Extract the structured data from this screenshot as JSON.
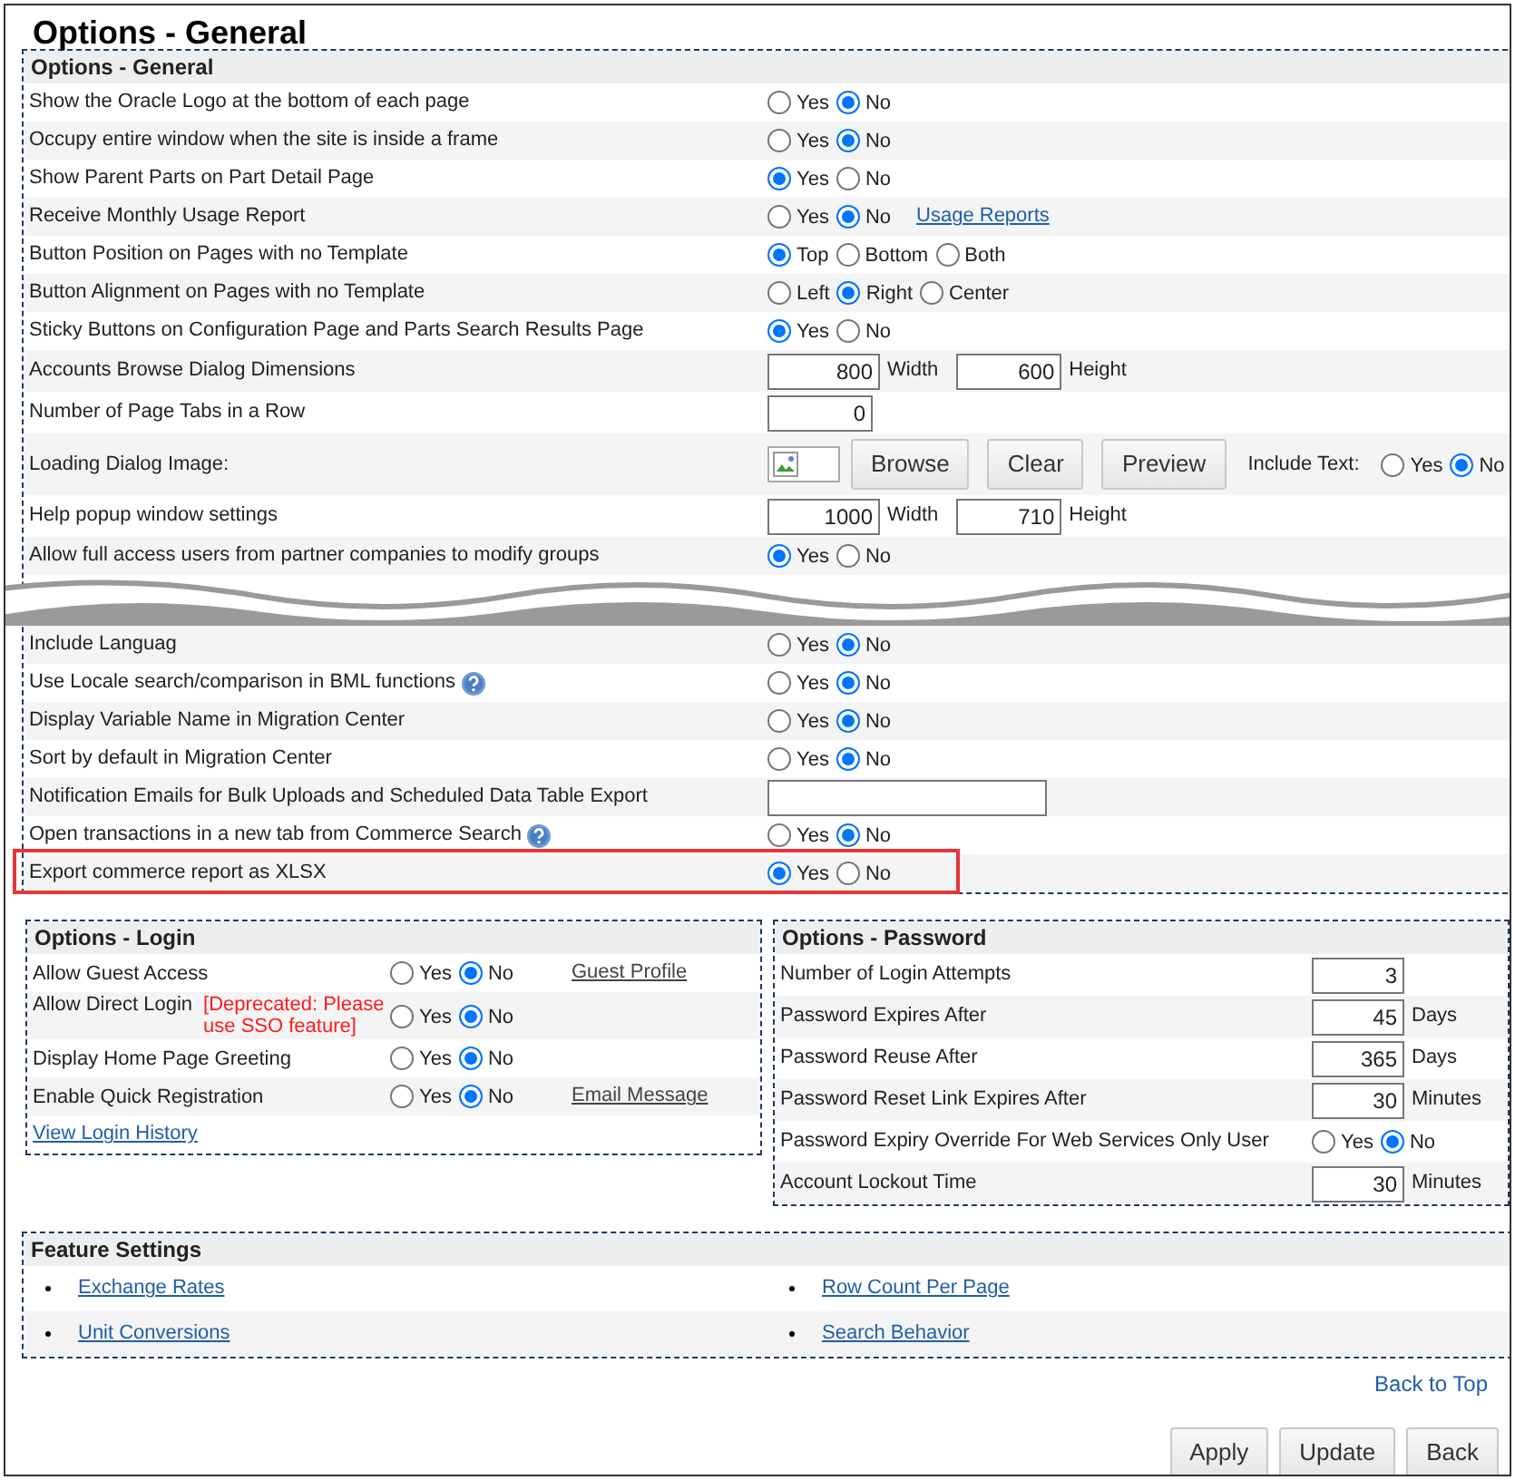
{
  "page_title": "Options - General",
  "general": {
    "title": "Options - General",
    "rows": [
      {
        "kind": "radio",
        "label": "Show the Oracle Logo at the bottom of each page",
        "options": [
          {
            "label": "Yes",
            "selected": false
          },
          {
            "label": "No",
            "selected": true
          }
        ]
      },
      {
        "kind": "radio",
        "label": "Occupy entire window when the site is inside a frame",
        "options": [
          {
            "label": "Yes",
            "selected": false
          },
          {
            "label": "No",
            "selected": true
          }
        ]
      },
      {
        "kind": "radio",
        "label": "Show Parent Parts on Part Detail Page",
        "options": [
          {
            "label": "Yes",
            "selected": true
          },
          {
            "label": "No",
            "selected": false
          }
        ]
      },
      {
        "kind": "radio",
        "label": "Receive Monthly Usage Report",
        "options": [
          {
            "label": "Yes",
            "selected": false
          },
          {
            "label": "No",
            "selected": true
          }
        ],
        "link": "Usage Reports"
      },
      {
        "kind": "radio",
        "label": "Button Position on Pages with no Template",
        "options": [
          {
            "label": "Top",
            "selected": true
          },
          {
            "label": "Bottom",
            "selected": false
          },
          {
            "label": "Both",
            "selected": false
          }
        ]
      },
      {
        "kind": "radio",
        "label": "Button Alignment on Pages with no Template",
        "options": [
          {
            "label": "Left",
            "selected": false
          },
          {
            "label": "Right",
            "selected": true
          },
          {
            "label": "Center",
            "selected": false
          }
        ]
      },
      {
        "kind": "radio",
        "label": "Sticky Buttons on Configuration Page and Parts Search Results Page",
        "options": [
          {
            "label": "Yes",
            "selected": true
          },
          {
            "label": "No",
            "selected": false
          }
        ]
      },
      {
        "kind": "dimensions",
        "label": "Accounts Browse Dialog Dimensions",
        "fields": [
          {
            "value": "800",
            "unit": "Width"
          },
          {
            "value": "600",
            "unit": "Height"
          }
        ]
      },
      {
        "kind": "number",
        "label": "Number of Page Tabs in a Row",
        "value": "0"
      },
      {
        "kind": "image",
        "label": "Loading Dialog Image:",
        "buttons": [
          "Browse",
          "Clear",
          "Preview"
        ],
        "include_label": "Include Text:",
        "options": [
          {
            "label": "Yes",
            "selected": false
          },
          {
            "label": "No",
            "selected": true
          }
        ]
      },
      {
        "kind": "dimensions",
        "label": "Help popup window settings",
        "fields": [
          {
            "value": "1000",
            "unit": "Width"
          },
          {
            "value": "710",
            "unit": "Height"
          }
        ]
      },
      {
        "kind": "radio",
        "label": "Allow full access users from partner companies to modify groups",
        "options": [
          {
            "label": "Yes",
            "selected": true
          },
          {
            "label": "No",
            "selected": false
          }
        ]
      }
    ],
    "rows_after_tear": [
      {
        "kind": "radio",
        "label": "Include Languag",
        "help": false,
        "highlighted": false,
        "options": [
          {
            "label": "Yes",
            "selected": false
          },
          {
            "label": "No",
            "selected": true
          }
        ]
      },
      {
        "kind": "radio",
        "label": "Use Locale search/comparison in BML functions",
        "help": true,
        "highlighted": false,
        "options": [
          {
            "label": "Yes",
            "selected": false
          },
          {
            "label": "No",
            "selected": true
          }
        ]
      },
      {
        "kind": "radio",
        "label": "Display Variable Name in Migration Center",
        "help": false,
        "highlighted": false,
        "options": [
          {
            "label": "Yes",
            "selected": false
          },
          {
            "label": "No",
            "selected": true
          }
        ]
      },
      {
        "kind": "radio",
        "label": "Sort by default in Migration Center",
        "help": false,
        "highlighted": false,
        "options": [
          {
            "label": "Yes",
            "selected": false
          },
          {
            "label": "No",
            "selected": true
          }
        ]
      },
      {
        "kind": "text",
        "label": "Notification Emails for Bulk Uploads and Scheduled Data Table Export",
        "help": false,
        "highlighted": false
      },
      {
        "kind": "radio",
        "label": "Open transactions in a new tab from Commerce Search",
        "help": true,
        "highlighted": false,
        "options": [
          {
            "label": "Yes",
            "selected": false
          },
          {
            "label": "No",
            "selected": true
          }
        ]
      },
      {
        "kind": "radio",
        "label": "Export commerce report as XLSX",
        "help": false,
        "highlighted": true,
        "options": [
          {
            "label": "Yes",
            "selected": true
          },
          {
            "label": "No",
            "selected": false
          }
        ]
      }
    ]
  },
  "login": {
    "title": "Options - Login",
    "rows": [
      {
        "label": "Allow Guest Access",
        "options": [
          {
            "label": "Yes",
            "selected": false
          },
          {
            "label": "No",
            "selected": true
          }
        ],
        "link": "Guest Profile"
      },
      {
        "label": "Allow Direct Login",
        "note": "[Deprecated: Please use SSO feature]",
        "options": [
          {
            "label": "Yes",
            "selected": false
          },
          {
            "label": "No",
            "selected": true
          }
        ]
      },
      {
        "label": "Display Home Page Greeting",
        "options": [
          {
            "label": "Yes",
            "selected": false
          },
          {
            "label": "No",
            "selected": true
          }
        ]
      },
      {
        "label": "Enable Quick Registration",
        "options": [
          {
            "label": "Yes",
            "selected": false
          },
          {
            "label": "No",
            "selected": true
          }
        ],
        "link": "Email Message"
      }
    ],
    "history_link": "View Login History"
  },
  "password": {
    "title": "Options - Password",
    "rows": [
      {
        "kind": "number",
        "label": "Number of Login Attempts",
        "value": "3"
      },
      {
        "kind": "number",
        "label": "Password Expires After",
        "value": "45",
        "unit": "Days"
      },
      {
        "kind": "number",
        "label": "Password Reuse After",
        "value": "365",
        "unit": "Days"
      },
      {
        "kind": "number",
        "label": "Password Reset Link Expires After",
        "value": "30",
        "unit": "Minutes"
      },
      {
        "kind": "radio",
        "label": "Password Expiry Override For Web Services Only User",
        "options": [
          {
            "label": "Yes",
            "selected": false
          },
          {
            "label": "No",
            "selected": true
          }
        ]
      },
      {
        "kind": "number",
        "label": "Account Lockout Time",
        "value": "30",
        "unit": "Minutes"
      }
    ]
  },
  "features": {
    "title": "Feature Settings",
    "links": [
      "Exchange Rates",
      "Row Count Per Page",
      "Unit Conversions",
      "Search Behavior"
    ]
  },
  "back_to_top": "Back to Top",
  "buttons": [
    "Apply",
    "Update",
    "Back"
  ]
}
